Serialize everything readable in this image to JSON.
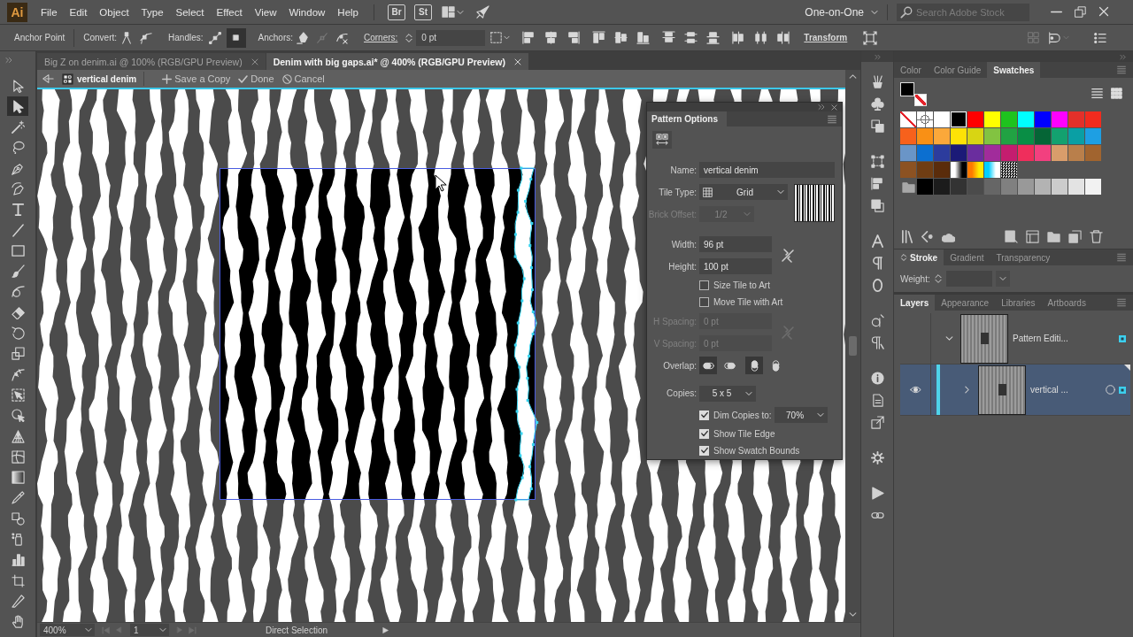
{
  "app": {
    "logo": "Ai",
    "bridge": "Br",
    "stock": "St"
  },
  "menu": [
    "File",
    "Edit",
    "Object",
    "Type",
    "Select",
    "Effect",
    "View",
    "Window",
    "Help"
  ],
  "workspace": "One-on-One",
  "search": {
    "placeholder": "Search Adobe Stock"
  },
  "control_bar": {
    "selection": "Anchor Point",
    "convert": "Convert:",
    "handles": "Handles:",
    "handle_buttons": [
      {
        "selected": false
      },
      {
        "selected": true
      }
    ],
    "anchors": "Anchors:",
    "corners": "Corners:",
    "corner_radius": "0 pt",
    "transform": "Transform"
  },
  "documents": [
    {
      "title": "Big Z on denim.ai @ 100% (RGB/GPU Preview)",
      "selected": false
    },
    {
      "title": "Denim with big gaps.ai* @ 400% (RGB/GPU Preview)",
      "selected": true
    }
  ],
  "isolation_bar": {
    "pattern": "vertical denim",
    "actions": [
      {
        "kind": "save",
        "label": "Save a Copy"
      },
      {
        "kind": "done",
        "label": "Done"
      },
      {
        "kind": "cancel",
        "label": "Cancel"
      }
    ]
  },
  "tools": [
    {
      "kind": "selection",
      "selected": false
    },
    {
      "kind": "direct_selection",
      "selected": true
    },
    {
      "kind": "magic_wand",
      "selected": false
    },
    {
      "kind": "lasso",
      "selected": false
    },
    {
      "kind": "pen",
      "selected": false
    },
    {
      "kind": "curvature",
      "selected": false
    },
    {
      "kind": "type",
      "selected": false
    },
    {
      "kind": "line",
      "selected": false
    },
    {
      "kind": "rectangle",
      "selected": false
    },
    {
      "kind": "paintbrush",
      "selected": false
    },
    {
      "kind": "shaper",
      "selected": false
    },
    {
      "kind": "eraser",
      "selected": false
    },
    {
      "kind": "rotate",
      "selected": false
    },
    {
      "kind": "scale",
      "selected": false
    },
    {
      "kind": "width",
      "selected": false
    },
    {
      "kind": "free_transform",
      "selected": false
    },
    {
      "kind": "shape_builder",
      "selected": false
    },
    {
      "kind": "perspective_grid",
      "selected": false
    },
    {
      "kind": "mesh",
      "selected": false
    },
    {
      "kind": "gradient",
      "selected": false
    },
    {
      "kind": "eyedropper",
      "selected": false
    },
    {
      "kind": "blend",
      "selected": false
    },
    {
      "kind": "symbol_sprayer",
      "selected": false
    },
    {
      "kind": "column_graph",
      "selected": false
    },
    {
      "kind": "artboard",
      "selected": false
    },
    {
      "kind": "slice",
      "selected": false
    },
    {
      "kind": "hand",
      "selected": false
    }
  ],
  "pattern_options": {
    "title": "Pattern Options",
    "name": {
      "label": "Name:",
      "value": "vertical denim"
    },
    "tile_type": {
      "label": "Tile Type:",
      "value": "Grid"
    },
    "brick_offset": {
      "label": "Brick Offset:",
      "value": "1/2",
      "disabled": true
    },
    "width": {
      "label": "Width:",
      "value": "96 pt"
    },
    "height": {
      "label": "Height:",
      "value": "100 pt"
    },
    "tile_options": [
      {
        "label": "Size Tile to Art",
        "checked": false
      },
      {
        "label": "Move Tile with Art",
        "checked": false
      }
    ],
    "h_spacing": {
      "label": "H Spacing:",
      "value": "0 pt",
      "disabled": true
    },
    "v_spacing": {
      "label": "V Spacing:",
      "value": "0 pt",
      "disabled": true
    },
    "overlap": {
      "label": "Overlap:",
      "buttons": [
        {
          "kind": "left",
          "selected": true
        },
        {
          "kind": "right",
          "selected": false
        },
        {
          "kind": "top",
          "selected": true
        },
        {
          "kind": "bottom",
          "selected": false
        }
      ]
    },
    "copies": {
      "label": "Copies:",
      "value": "5 x 5"
    },
    "dim_copies": {
      "label": "Dim Copies to:",
      "checked": true,
      "value": "70%"
    },
    "display_options": [
      {
        "label": "Show Tile Edge",
        "checked": true
      },
      {
        "label": "Show Swatch Bounds",
        "checked": true
      }
    ]
  },
  "status_bar": {
    "zoom": "400%",
    "artboard": "1",
    "current_tool": "Direct Selection"
  },
  "swatches_panel": {
    "tabs": [
      {
        "label": "Color",
        "selected": false
      },
      {
        "label": "Color Guide",
        "selected": false
      },
      {
        "label": "Swatches",
        "selected": true
      }
    ],
    "fill": {
      "color": "#000000"
    },
    "stroke": {
      "kind": "none"
    },
    "swatches": [
      {
        "kind": "none",
        "selected": false
      },
      {
        "kind": "registration",
        "selected": false
      },
      {
        "kind": "color",
        "color": "#ffffff",
        "selected": false
      },
      {
        "kind": "color",
        "color": "#000000",
        "selected": true
      },
      {
        "kind": "color",
        "color": "#ff0000",
        "selected": false
      },
      {
        "kind": "color",
        "color": "#ffff00",
        "selected": false
      },
      {
        "kind": "color",
        "color": "#1ec31e",
        "selected": false
      },
      {
        "kind": "color",
        "color": "#00ffff",
        "selected": false
      },
      {
        "kind": "color",
        "color": "#0000ff",
        "selected": false
      },
      {
        "kind": "color",
        "color": "#ff00ff",
        "selected": false
      },
      {
        "kind": "color",
        "color": "#e3302a",
        "selected": false
      },
      {
        "kind": "color",
        "color": "#f22b1e",
        "selected": false
      },
      {
        "kind": "color",
        "color": "#f7611c",
        "selected": false
      },
      {
        "kind": "color",
        "color": "#f99015",
        "selected": false
      },
      {
        "kind": "color",
        "color": "#fba83a",
        "selected": false
      },
      {
        "kind": "color",
        "color": "#fde206",
        "selected": false
      },
      {
        "kind": "color",
        "color": "#d8d513",
        "selected": false
      },
      {
        "kind": "color",
        "color": "#82c341",
        "selected": false
      },
      {
        "kind": "color",
        "color": "#21a243",
        "selected": false
      },
      {
        "kind": "color",
        "color": "#098e45",
        "selected": false
      },
      {
        "kind": "color",
        "color": "#056536",
        "selected": false
      },
      {
        "kind": "color",
        "color": "#13a16f",
        "selected": false
      },
      {
        "kind": "color",
        "color": "#0a9fa4",
        "selected": false
      },
      {
        "kind": "color",
        "color": "#1e9fe3",
        "selected": false
      },
      {
        "kind": "color",
        "color": "#6a95c7",
        "selected": false
      },
      {
        "kind": "color",
        "color": "#0c6fd0",
        "selected": false
      },
      {
        "kind": "color",
        "color": "#2c3c9d",
        "selected": false
      },
      {
        "kind": "color",
        "color": "#1b1a77",
        "selected": false
      },
      {
        "kind": "color",
        "color": "#6a2d9e",
        "selected": false
      },
      {
        "kind": "color",
        "color": "#a12c9b",
        "selected": false
      },
      {
        "kind": "color",
        "color": "#c41d6f",
        "selected": false
      },
      {
        "kind": "color",
        "color": "#ef2e5c",
        "selected": false
      },
      {
        "kind": "color",
        "color": "#f2407f",
        "selected": false
      },
      {
        "kind": "color",
        "color": "#d99d6b",
        "selected": false
      },
      {
        "kind": "color",
        "color": "#b97f4b",
        "selected": false
      },
      {
        "kind": "color",
        "color": "#a1642f",
        "selected": false
      },
      {
        "kind": "color",
        "color": "#8c5222",
        "selected": false
      },
      {
        "kind": "color",
        "color": "#6f3d13",
        "selected": false
      },
      {
        "kind": "color",
        "color": "#5a2c0b",
        "selected": false
      },
      {
        "kind": "gradient",
        "stops": [
          {
            "color": "#ffffff"
          },
          {
            "color": "#000000"
          }
        ],
        "selected": false
      },
      {
        "kind": "gradient",
        "stops": [
          {
            "color": "#ff7a00"
          },
          {
            "color": "#ffea00"
          }
        ],
        "selected": false
      },
      {
        "kind": "gradient",
        "stops": [
          {
            "color": "#00cfff"
          },
          {
            "color": "#ffffff"
          }
        ],
        "selected": false
      },
      {
        "kind": "pattern",
        "selected": false
      }
    ],
    "color_groups": [
      {
        "swatches": [
          {
            "kind": "color",
            "color": "#000000",
            "selected": false
          },
          {
            "kind": "color",
            "color": "#1c1c1c",
            "selected": false
          },
          {
            "kind": "color",
            "color": "#333333",
            "selected": false
          },
          {
            "kind": "color",
            "color": "#4b4b4b",
            "selected": false
          },
          {
            "kind": "color",
            "color": "#666666",
            "selected": false
          },
          {
            "kind": "color",
            "color": "#808080",
            "selected": false
          },
          {
            "kind": "color",
            "color": "#999999",
            "selected": false
          },
          {
            "kind": "color",
            "color": "#b3b3b3",
            "selected": false
          },
          {
            "kind": "color",
            "color": "#cccccc",
            "selected": false
          },
          {
            "kind": "color",
            "color": "#e3e3e3",
            "selected": false
          },
          {
            "kind": "color",
            "color": "#f2f2f2",
            "selected": false
          }
        ]
      }
    ]
  },
  "stroke_panel": {
    "tabs": [
      {
        "label": "Stroke",
        "selected": true,
        "options_toggle": true
      },
      {
        "label": "Gradient",
        "selected": false,
        "options_toggle": false
      },
      {
        "label": "Transparency",
        "selected": false,
        "options_toggle": false
      }
    ],
    "weight_label": "Weight:"
  },
  "layers_panel": {
    "tabs": [
      {
        "label": "Layers",
        "selected": true
      },
      {
        "label": "Appearance",
        "selected": false
      },
      {
        "label": "Libraries",
        "selected": false
      },
      {
        "label": "Artboards",
        "selected": false
      }
    ],
    "layers": [
      {
        "name": "Pattern Editi...",
        "visible": false,
        "expanded": true,
        "selected": false,
        "targeted": false,
        "has_selection": true,
        "children": [
          {
            "name": "vertical ...",
            "visible": true,
            "expanded": false,
            "selected": true,
            "targeted": true,
            "has_selection": true,
            "color": "#4fd3ea"
          }
        ]
      }
    ]
  }
}
